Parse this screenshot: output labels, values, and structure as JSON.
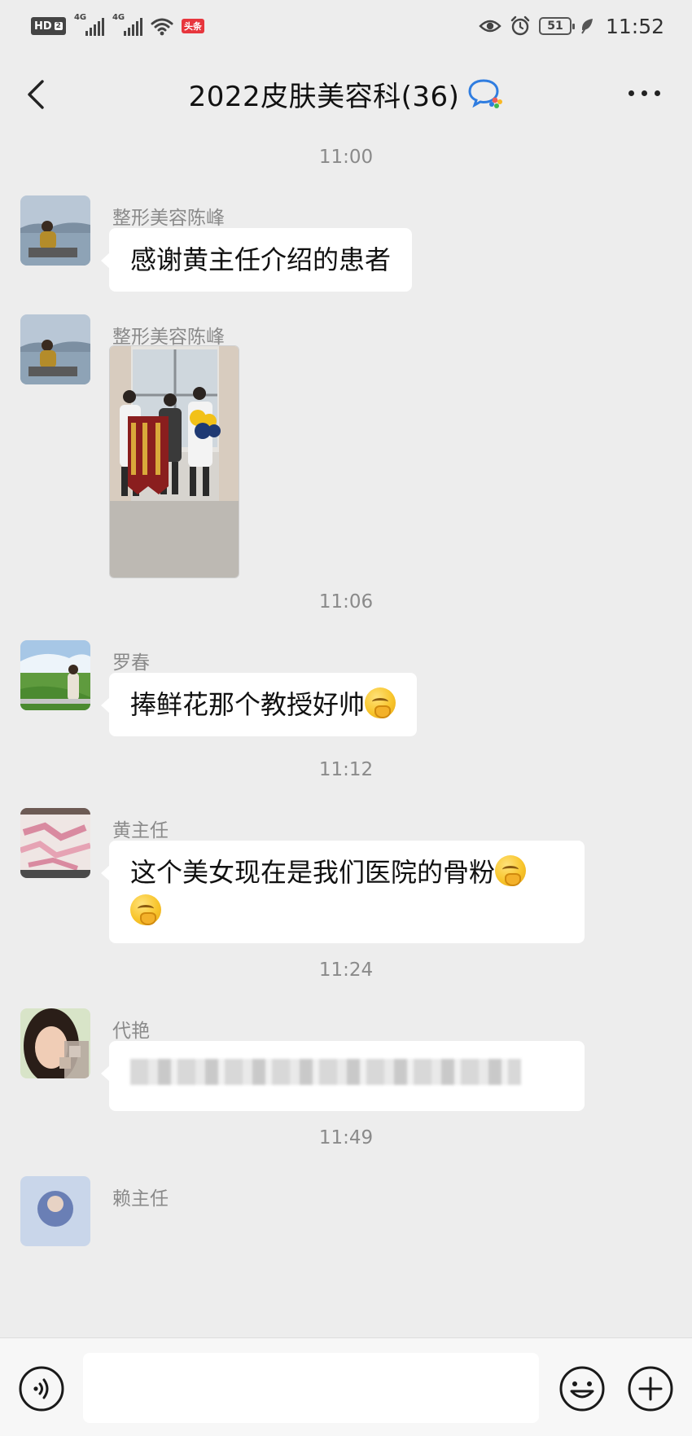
{
  "status_bar": {
    "hd_label": "HD",
    "hd_sub": "2",
    "signal1_label": "4G",
    "signal2_label": "4G",
    "toutiao_label": "头条",
    "battery_level": "51",
    "time": "11:52"
  },
  "header": {
    "title": "2022皮肤美容科(36)"
  },
  "chat": {
    "timestamps": [
      "11:00",
      "11:06",
      "11:12",
      "11:24",
      "11:49"
    ],
    "messages": [
      {
        "sender": "整形美容陈峰",
        "text": "感谢黄主任介绍的患者"
      },
      {
        "sender": "整形美容陈峰",
        "type": "image"
      },
      {
        "sender": "罗春",
        "text": "捧鲜花那个教授好帅"
      },
      {
        "sender": "黄主任",
        "text_line1": "这个美女现在是我们医院的骨粉"
      },
      {
        "sender": "代艳",
        "type": "blurred"
      },
      {
        "sender": "赖主任"
      }
    ]
  },
  "input_bar": {
    "placeholder": ""
  },
  "colors": {
    "background": "#ededed",
    "bubble": "#ffffff",
    "muted_text": "#8a8a8a",
    "toutiao_red": "#e7363d"
  }
}
